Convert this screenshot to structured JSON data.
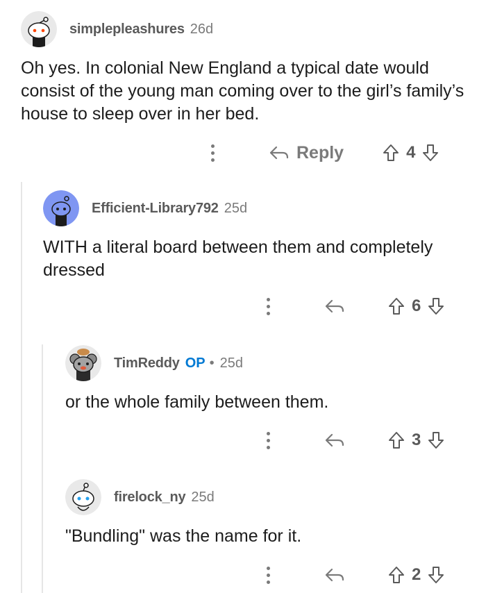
{
  "comments": [
    {
      "username": "simplepleashures",
      "age": "26d",
      "text": "Oh yes. In colonial New England a typical date would consist of the young man coming over to the girl’s family’s house to sleep over in her bed.",
      "reply_label": "Reply",
      "score": "4",
      "avatar_icon": "snoo-avatar-icon"
    },
    {
      "username": "Efficient-Library792",
      "age": "25d",
      "text": "WITH a literal board between them and completely dressed",
      "score": "6",
      "avatar_icon": "snoo-avatar-icon"
    },
    {
      "username": "TimReddy",
      "op_badge": "OP",
      "separator": "•",
      "age": "25d",
      "text": "or the whole family between them.",
      "score": "3",
      "avatar_icon": "snoo-avatar-icon"
    },
    {
      "username": "firelock_ny",
      "age": "25d",
      "text": "\"Bundling\" was the name for it.",
      "score": "2",
      "avatar_icon": "snoo-avatar-icon"
    }
  ],
  "colors": {
    "accent": "#0079d3",
    "thread_line": "#e6e6e6",
    "muted": "#7a7a7a"
  }
}
